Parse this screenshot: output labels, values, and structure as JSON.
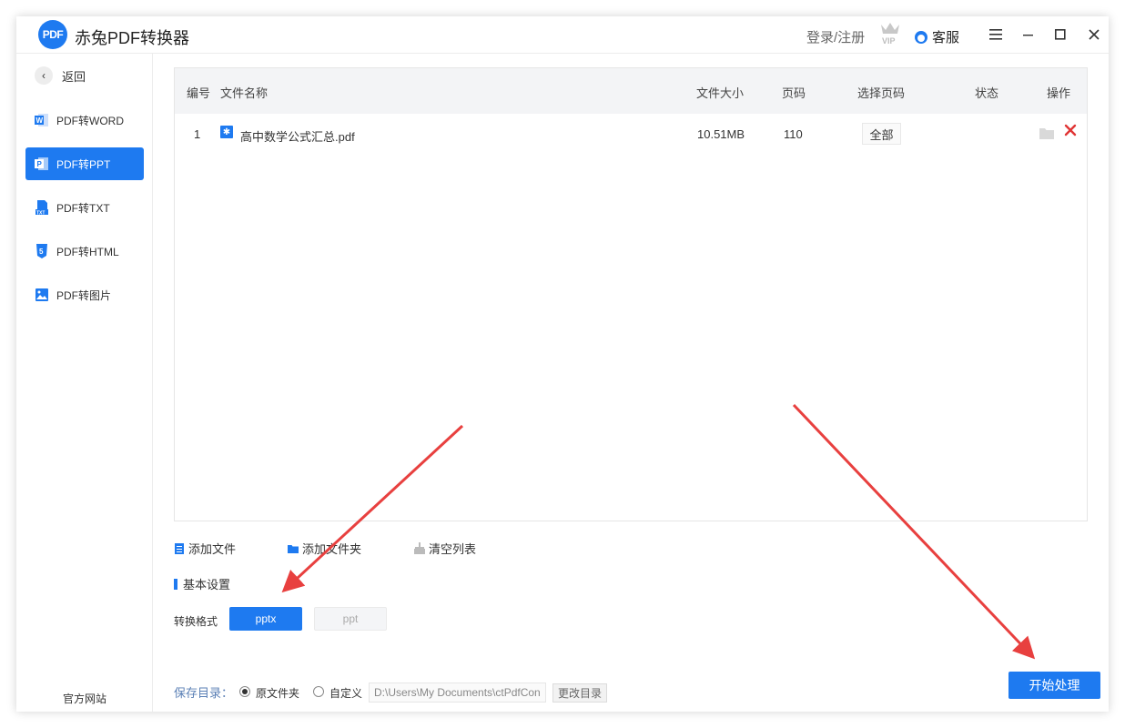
{
  "window": {
    "title": "赤兔PDF转换器",
    "logo_text": "PDF",
    "login_label": "登录/注册",
    "vip_icon": "vip-crown-icon",
    "service_label": "客服",
    "buttons": [
      "menu",
      "minimize",
      "maximize",
      "close"
    ]
  },
  "sidebar": {
    "back_label": "返回",
    "items": [
      {
        "label": "PDF转WORD",
        "icon": "word-icon",
        "active": false
      },
      {
        "label": "PDF转PPT",
        "icon": "ppt-icon",
        "active": true
      },
      {
        "label": "PDF转TXT",
        "icon": "txt-icon",
        "active": false
      },
      {
        "label": "PDF转HTML",
        "icon": "html-icon",
        "active": false
      },
      {
        "label": "PDF转图片",
        "icon": "image-icon",
        "active": false
      }
    ],
    "footer_label": "官方网站"
  },
  "table": {
    "columns": [
      "编号",
      "文件名称",
      "文件大小",
      "页码",
      "选择页码",
      "状态",
      "操作"
    ],
    "rows": [
      {
        "index": "1",
        "name": "高中数学公式汇总.pdf",
        "size": "10.51MB",
        "pages": "110",
        "page_select": "全部",
        "status": ""
      }
    ]
  },
  "actions": {
    "add_file": "添加文件",
    "add_folder": "添加文件夹",
    "clear_list": "清空列表"
  },
  "settings": {
    "section_title": "基本设置",
    "format_label": "转换格式",
    "formats": [
      {
        "label": "pptx",
        "selected": true
      },
      {
        "label": "ppt",
        "selected": false
      }
    ]
  },
  "save": {
    "label": "保存目录：",
    "option_original": "原文件夹",
    "option_custom": "自定义",
    "selected": "原文件夹",
    "path_value": "D:\\Users\\My Documents\\ctPdfCon",
    "change_label": "更改目录"
  },
  "start_label": "开始处理",
  "colors": {
    "accent": "#1e7af0",
    "delete": "#e03535",
    "annotation_arrow": "#e8403f"
  }
}
